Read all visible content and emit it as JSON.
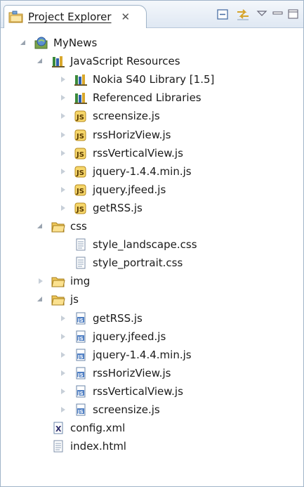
{
  "view": {
    "title": "Project Explorer",
    "close_glyph": "✕"
  },
  "tree": [
    {
      "label": "MyNews",
      "icon": "project-icon",
      "level": 0,
      "state": "expanded"
    },
    {
      "label": "JavaScript Resources",
      "icon": "library-icon",
      "level": 1,
      "state": "expanded"
    },
    {
      "label": "Nokia S40 Library [1.5]",
      "icon": "library-icon",
      "level": 2,
      "state": "collapsed"
    },
    {
      "label": "Referenced Libraries",
      "icon": "library-icon",
      "level": 2,
      "state": "collapsed"
    },
    {
      "label": "screensize.js",
      "icon": "js-resource-icon",
      "level": 2,
      "state": "collapsed"
    },
    {
      "label": "rssHorizView.js",
      "icon": "js-resource-icon",
      "level": 2,
      "state": "collapsed"
    },
    {
      "label": "rssVerticalView.js",
      "icon": "js-resource-icon",
      "level": 2,
      "state": "collapsed"
    },
    {
      "label": "jquery-1.4.4.min.js",
      "icon": "js-resource-icon",
      "level": 2,
      "state": "collapsed"
    },
    {
      "label": "jquery.jfeed.js",
      "icon": "js-resource-icon",
      "level": 2,
      "state": "collapsed"
    },
    {
      "label": "getRSS.js",
      "icon": "js-resource-icon",
      "level": 2,
      "state": "collapsed"
    },
    {
      "label": "css",
      "icon": "folder-icon",
      "level": 1,
      "state": "expanded"
    },
    {
      "label": "style_landscape.css",
      "icon": "css-file-icon",
      "level": 2,
      "state": "none"
    },
    {
      "label": "style_portrait.css",
      "icon": "css-file-icon",
      "level": 2,
      "state": "none"
    },
    {
      "label": "img",
      "icon": "folder-icon",
      "level": 1,
      "state": "collapsed"
    },
    {
      "label": "js",
      "icon": "folder-icon",
      "level": 1,
      "state": "expanded"
    },
    {
      "label": "getRSS.js",
      "icon": "js-file-icon",
      "level": 2,
      "state": "collapsed"
    },
    {
      "label": "jquery.jfeed.js",
      "icon": "js-file-icon",
      "level": 2,
      "state": "collapsed"
    },
    {
      "label": "jquery-1.4.4.min.js",
      "icon": "js-file-icon",
      "level": 2,
      "state": "collapsed"
    },
    {
      "label": "rssHorizView.js",
      "icon": "js-file-icon",
      "level": 2,
      "state": "collapsed"
    },
    {
      "label": "rssVerticalView.js",
      "icon": "js-file-icon",
      "level": 2,
      "state": "collapsed"
    },
    {
      "label": "screensize.js",
      "icon": "js-file-icon",
      "level": 2,
      "state": "collapsed"
    },
    {
      "label": "config.xml",
      "icon": "xml-file-icon",
      "level": 1,
      "state": "none"
    },
    {
      "label": "index.html",
      "icon": "html-file-icon",
      "level": 1,
      "state": "none"
    }
  ]
}
